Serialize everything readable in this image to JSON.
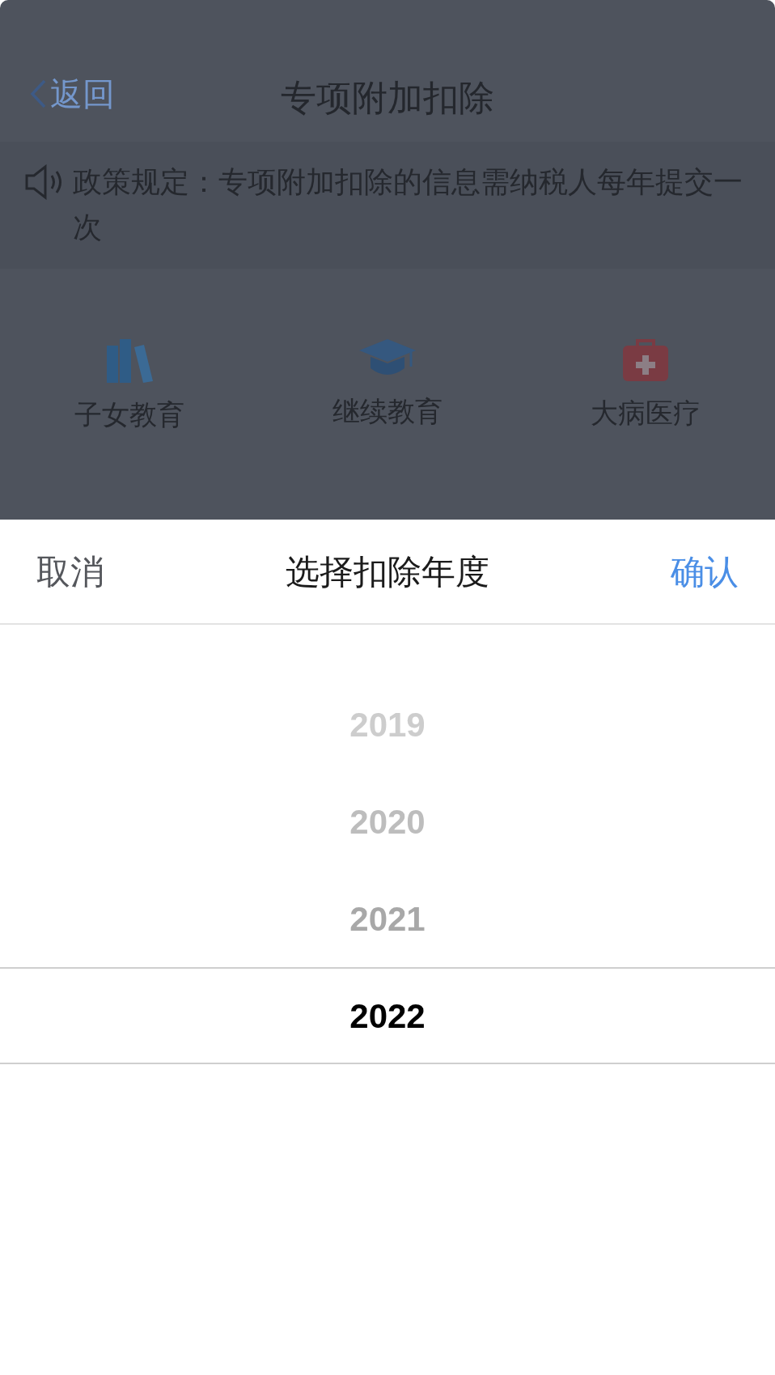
{
  "nav_bar": {
    "back": "返回",
    "title": "专项附加扣除"
  },
  "notice": "政策规定：专项附加扣除的信息需纳税人每年提交一次",
  "categories": [
    {
      "label": "子女教育",
      "kind": "books"
    },
    {
      "label": "继续教育",
      "kind": "cap"
    },
    {
      "label": "大病医疗",
      "kind": "medkit"
    }
  ],
  "sheet": {
    "cancel": "取消",
    "title": "选择扣除年度",
    "confirm": "确认",
    "years": [
      {
        "label": "2019",
        "selected": false
      },
      {
        "label": "2020",
        "selected": false
      },
      {
        "label": "2021",
        "selected": false
      },
      {
        "label": "2022",
        "selected": true
      }
    ]
  }
}
